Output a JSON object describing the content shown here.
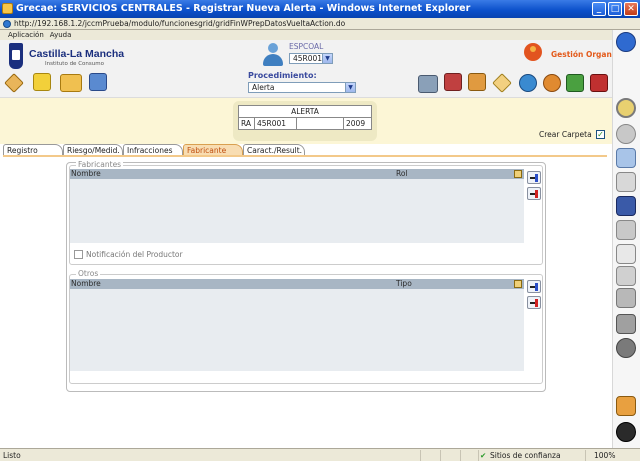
{
  "window": {
    "title": "Grecae: SERVICIOS CENTRALES - Registrar Nueva Alerta - Windows Internet Explorer",
    "url": "http://192.168.1.2/jccmPrueba/modulo/funcionesgrid/gridFinWPrepDatosVueltaAction.do",
    "minimize": "_",
    "maximize": "□",
    "close": "✕"
  },
  "menu": [
    "Aplicación",
    "Ayuda"
  ],
  "header": {
    "org_name": "Castilla-La Mancha",
    "org_sub": "Instituto de Consumo",
    "user_label": "ESPCOAL",
    "user_select": "45R001",
    "gestion_label": "Gestión Organismo",
    "procedimiento_label": "Procedimiento:",
    "procedimiento_value": "Alerta"
  },
  "alerta": {
    "title": "ALERTA",
    "code_prefix": "RA",
    "code": "45R001",
    "number": "",
    "year": "2009"
  },
  "crear_carpeta": {
    "label": "Crear Carpeta",
    "checked": true
  },
  "tabs": [
    "Registro",
    "Riesgo/Medid.",
    "Infracciones",
    "Fabricante",
    "Caract./Result."
  ],
  "active_tab": "Fabricante",
  "fabricantes": {
    "legend": "Fabricantes",
    "columns": [
      "Nombre",
      "Rol"
    ],
    "notification_label": "Notificación del Productor"
  },
  "otros": {
    "legend": "Otros",
    "columns": [
      "Nombre",
      "Tipo"
    ]
  },
  "status": {
    "left": "Listo",
    "zone": "Sitios de confianza",
    "zoom": "100%"
  },
  "colors": {
    "titlebar": "#0a4fc9",
    "active_tab": "#f8ddb2",
    "band": "#fcf6d6",
    "grid_header": "#a8b6c4"
  }
}
